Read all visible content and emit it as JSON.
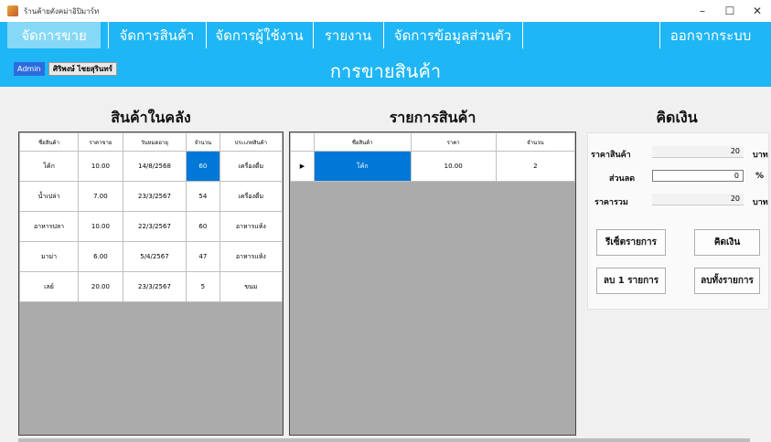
{
  "window": {
    "title": "ร้านค้ายตังคม่าอิปิมาร์ท",
    "controls": {
      "minimize": "–",
      "maximize": "☐",
      "close": "✕"
    }
  },
  "menu": {
    "items": [
      {
        "label": "จัดการขาย"
      },
      {
        "label": "จัดการสินค้า"
      },
      {
        "label": "จัดการผู้ใช้งาน"
      },
      {
        "label": "รายงาน"
      },
      {
        "label": "จัดการข้อมูลส่วนตัว"
      },
      {
        "label": "ออกจากระบบ"
      }
    ]
  },
  "header": {
    "role": "Admin",
    "user": "ศิริพงษ์ ไชยสุรินทร์",
    "title": "การขายสินค้า"
  },
  "inventory": {
    "title": "สินค้าในคลัง",
    "columns": [
      "ชื่อสินค้า",
      "ราคาขาย",
      "วันหมดอายุ",
      "จำนวน",
      "ประเภทสินค้า"
    ],
    "rows": [
      [
        "โค้ก",
        "10.00",
        "14/8/2568",
        "60",
        "เครื่องดื่ม"
      ],
      [
        "น้ำเปล่า",
        "7.00",
        "23/3/2567",
        "54",
        "เครื่องดื่ม"
      ],
      [
        "อาหารปลา",
        "10.00",
        "22/3/2567",
        "60",
        "อาหารแห้ง"
      ],
      [
        "มาม่า",
        "6.00",
        "5/4/2567",
        "47",
        "อาหารแห้ง"
      ],
      [
        "เลย์",
        "20.00",
        "23/3/2567",
        "5",
        "ขนม"
      ]
    ]
  },
  "cart": {
    "title": "รายการสินค้า",
    "columns": [
      "ชื่อสินค้า",
      "ราคา",
      "จำนวน"
    ],
    "rows": [
      [
        "โค้ก",
        "10.00",
        "2"
      ]
    ]
  },
  "checkout": {
    "title": "คิดเงิน",
    "price_label": "ราคาสินค้า",
    "price_value": "20",
    "price_unit": "บาท",
    "discount_label": "ส่วนลด",
    "discount_value": "0",
    "discount_unit": "%",
    "total_label": "ราคารวม",
    "total_value": "20",
    "total_unit": "บาท",
    "reset_label": "รีเซ็ตรายการ",
    "calc_label": "คิดเงิน",
    "delete_one_label": "ลบ 1 รายการ",
    "delete_all_label": "ลบทั้งรายการ"
  }
}
